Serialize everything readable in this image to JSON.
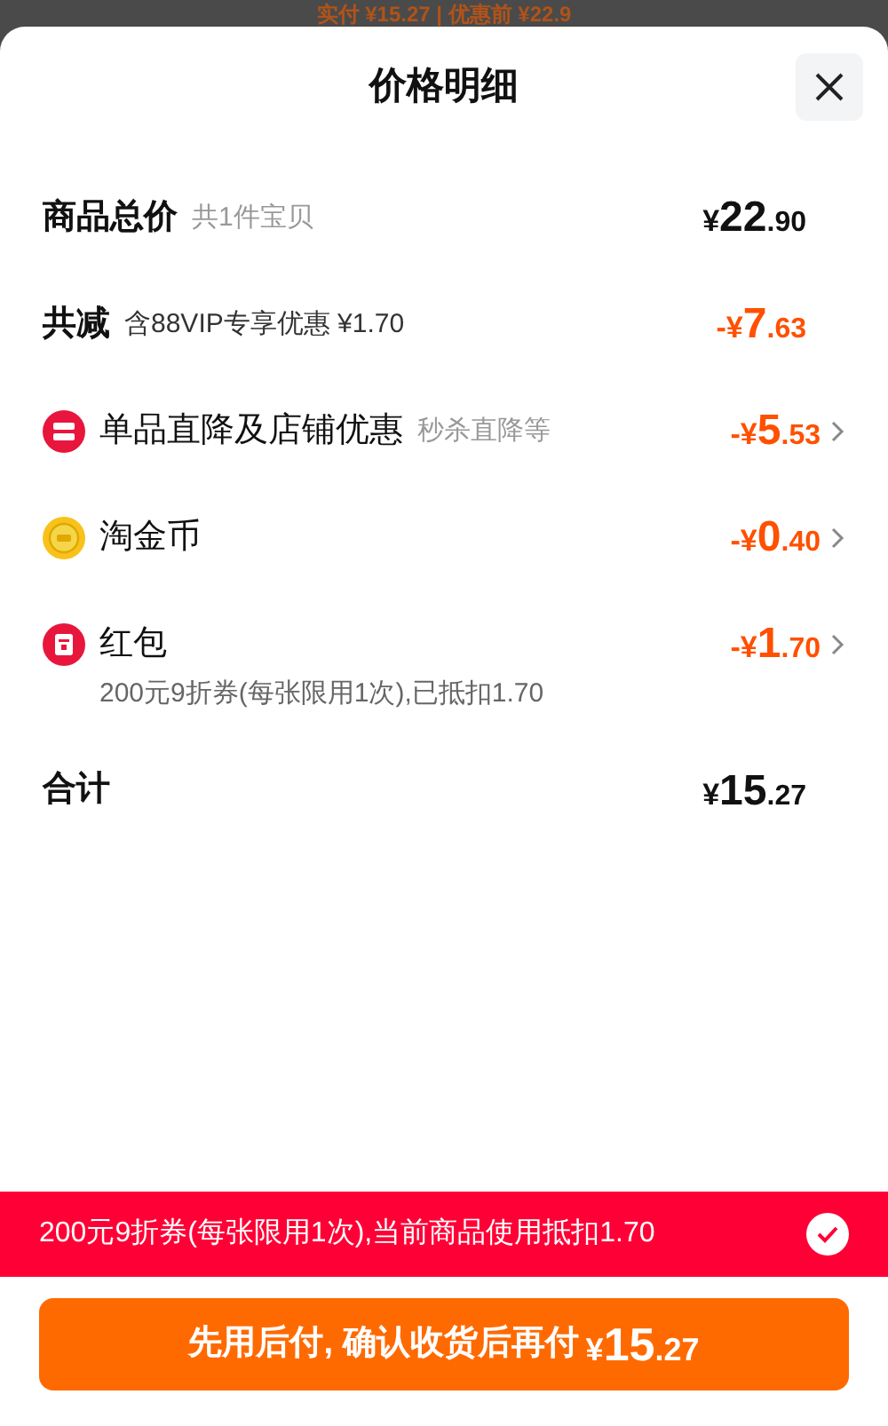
{
  "backdrop_text": "实付 ¥15.27 | 优惠前 ¥22.9",
  "title": "价格明细",
  "rows": [
    {
      "kind": "total",
      "label": "商品总价",
      "sublabel": "共1件宝贝",
      "amount": {
        "currency": "¥",
        "whole": "22",
        "fraction": ".90"
      },
      "discount": false,
      "has_detail": false
    },
    {
      "kind": "total",
      "label": "共减",
      "sublabel": "含88VIP专享优惠 ¥1.70",
      "amount": {
        "currency": "-¥",
        "whole": "7",
        "fraction": ".63"
      },
      "discount": true,
      "has_detail": false
    },
    {
      "kind": "shop",
      "label": "单品直降及店铺优惠",
      "sublabel": "秒杀直降等",
      "amount": {
        "currency": "-¥",
        "whole": "5",
        "fraction": ".53"
      },
      "discount": true,
      "has_detail": true
    },
    {
      "kind": "coin",
      "label": "淘金币",
      "amount": {
        "currency": "-¥",
        "whole": "0",
        "fraction": ".40"
      },
      "discount": true,
      "has_detail": true
    },
    {
      "kind": "redpacket",
      "label": "红包",
      "note": "200元9折券(每张限用1次),已抵扣1.70",
      "amount": {
        "currency": "-¥",
        "whole": "1",
        "fraction": ".70"
      },
      "discount": true,
      "has_detail": true
    },
    {
      "kind": "total",
      "label": "合计",
      "amount": {
        "currency": "¥",
        "whole": "15",
        "fraction": ".27"
      },
      "discount": false,
      "has_detail": false
    }
  ],
  "coupon_banner": {
    "text": "200元9折券(每张限用1次),当前商品使用抵扣1.70",
    "checked": true
  },
  "pay_button": {
    "label": "先用后付, 确认收货后再付",
    "amount": {
      "currency": "¥",
      "whole": "15",
      "fraction": ".27"
    }
  }
}
